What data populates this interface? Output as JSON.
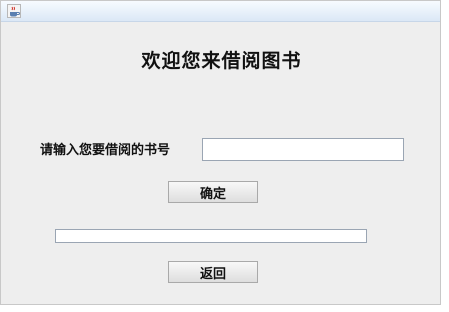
{
  "window": {
    "title": "",
    "icon": "java-cup-icon"
  },
  "main": {
    "heading": "欢迎您来借阅图书",
    "book_number_label": "请输入您要借阅的书号",
    "book_number_value": "",
    "result_value": "",
    "confirm_label": "确定",
    "back_label": "返回"
  },
  "colors": {
    "background": "#eeeeee",
    "titlebar": "#dbe8f6",
    "field_border": "#9aa5b3",
    "button_face": "#dedede"
  }
}
